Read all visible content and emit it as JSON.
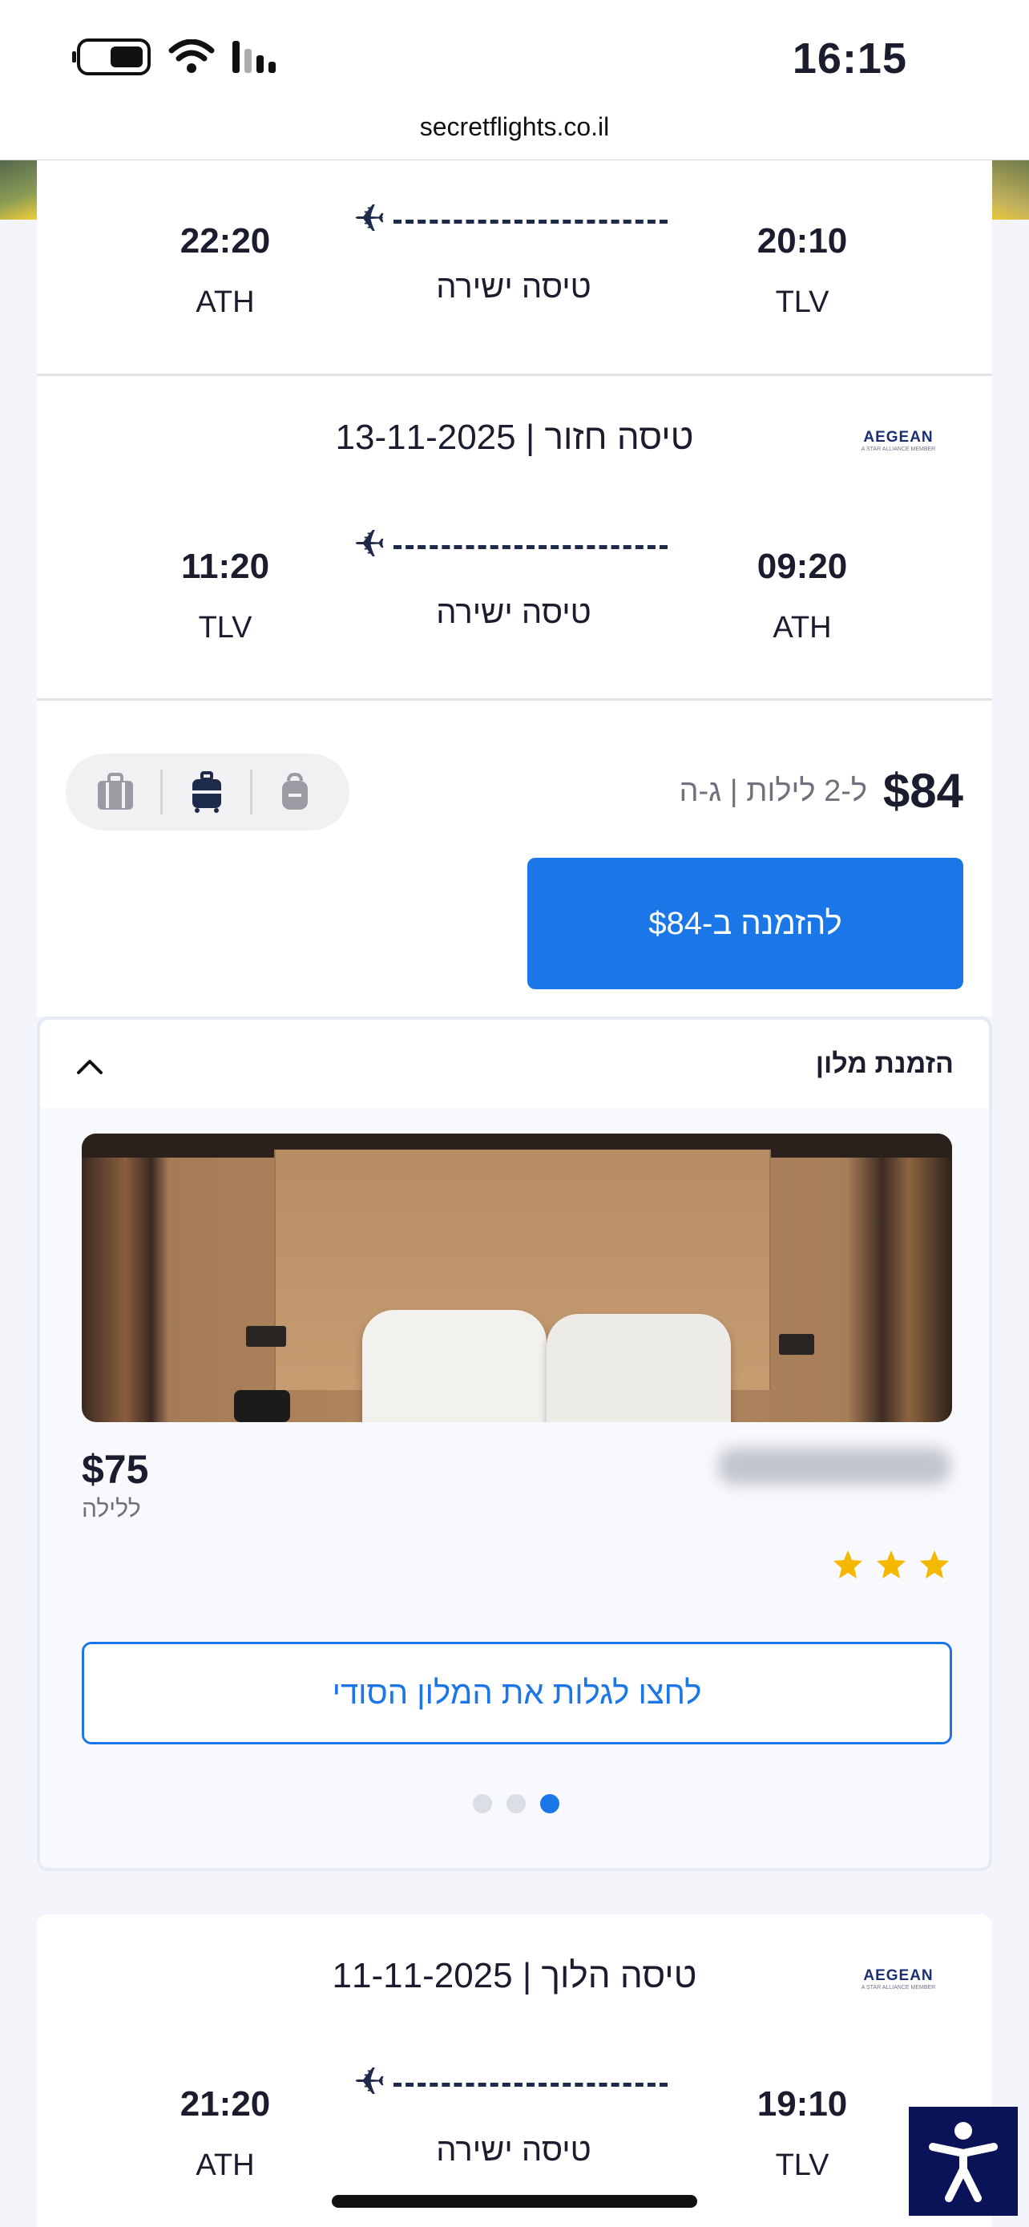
{
  "status_bar": {
    "time": "16:15",
    "url": "secretflights.co.il"
  },
  "outbound_top": {
    "depart_time": "20:10",
    "depart_code": "TLV",
    "arrive_time": "22:20",
    "arrive_code": "ATH",
    "type": "טיסה ישירה"
  },
  "return_leg": {
    "header": "13-11-2025 | טיסה חזור",
    "airline": "AEGEAN",
    "airline_sub": "A STAR ALLIANCE MEMBER",
    "depart_time": "09:20",
    "depart_code": "ATH",
    "arrive_time": "11:20",
    "arrive_code": "TLV",
    "type": "טיסה ישירה"
  },
  "price": {
    "amount": "$84",
    "details": "ל-2 לילות | ג-ה",
    "book_label": "להזמנה ב-$84"
  },
  "baggage": [
    "checked-bag-icon",
    "cabin-bag-icon",
    "personal-item-icon"
  ],
  "hotel": {
    "section_title": "הזמנת מלון",
    "price": "$75",
    "per_night": "ללילה",
    "stars": 3,
    "reveal_label": "לחצו לגלות את המלון הסודי",
    "dots": 3,
    "active_dot": 2
  },
  "next_offer": {
    "header": "11-11-2025 | טיסה הלוך",
    "airline": "AEGEAN",
    "airline_sub": "A STAR ALLIANCE MEMBER",
    "depart_time": "19:10",
    "depart_code": "TLV",
    "arrive_time": "21:20",
    "arrive_code": "ATH",
    "type": "טיסה ישירה"
  },
  "colors": {
    "accent": "#1b76e8",
    "navy": "#1e2a4a",
    "star": "#f5b800",
    "accessibility": "#0a1258"
  }
}
